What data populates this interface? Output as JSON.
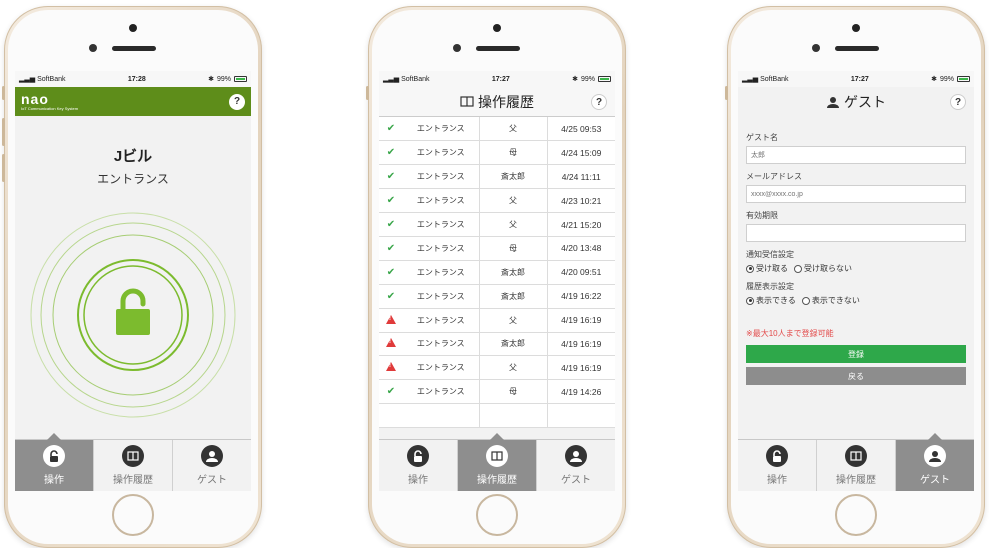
{
  "status": {
    "carrier": "SoftBank",
    "battery": "99%",
    "time_1": "17:28",
    "time_2": "17:27",
    "time_3": "17:27"
  },
  "colors": {
    "brand_green": "#5e8d1a",
    "ok_green": "#3aa64a",
    "warn_red": "#e03a3a",
    "button_green": "#2ea84a",
    "button_gray": "#8d8d8d",
    "active_tab": "#8e8e8e"
  },
  "screen1": {
    "logo": "nao",
    "logo_sub": "IoT Communication Key System",
    "help": "?",
    "building": "Jビル",
    "entrance": "エントランス",
    "lock_icon": "unlocked-padlock-icon"
  },
  "screen2": {
    "title": "操作履歴",
    "title_icon": "book-icon",
    "help": "?",
    "rows": [
      {
        "status": "ok",
        "location": "エントランス",
        "who": "父",
        "time": "4/25 09:53"
      },
      {
        "status": "ok",
        "location": "エントランス",
        "who": "母",
        "time": "4/24 15:09"
      },
      {
        "status": "ok",
        "location": "エントランス",
        "who": "斎太郎",
        "time": "4/24 11:11"
      },
      {
        "status": "ok",
        "location": "エントランス",
        "who": "父",
        "time": "4/23 10:21"
      },
      {
        "status": "ok",
        "location": "エントランス",
        "who": "父",
        "time": "4/21 15:20"
      },
      {
        "status": "ok",
        "location": "エントランス",
        "who": "母",
        "time": "4/20 13:48"
      },
      {
        "status": "ok",
        "location": "エントランス",
        "who": "斎太郎",
        "time": "4/20 09:51"
      },
      {
        "status": "ok",
        "location": "エントランス",
        "who": "斎太郎",
        "time": "4/19 16:22"
      },
      {
        "status": "warn",
        "location": "エントランス",
        "who": "父",
        "time": "4/19 16:19"
      },
      {
        "status": "warn",
        "location": "エントランス",
        "who": "斎太郎",
        "time": "4/19 16:19"
      },
      {
        "status": "warn",
        "location": "エントランス",
        "who": "父",
        "time": "4/19 16:19"
      },
      {
        "status": "ok",
        "location": "エントランス",
        "who": "母",
        "time": "4/19 14:26"
      },
      {
        "status": "",
        "location": "",
        "who": "",
        "time": ""
      }
    ]
  },
  "screen3": {
    "title": "ゲスト",
    "title_icon": "guest-icon",
    "help": "?",
    "guest_name_label": "ゲスト名",
    "guest_name_placeholder": "太郎",
    "email_label": "メールアドレス",
    "email_placeholder": "xxxx@xxxx.co.jp",
    "expiry_label": "有効期限",
    "expiry_value": "",
    "notify_label": "通知受信設定",
    "notify_options": [
      "受け取る",
      "受け取らない"
    ],
    "notify_selected": 0,
    "history_label": "履歴表示設定",
    "history_options": [
      "表示できる",
      "表示できない"
    ],
    "history_selected": 0,
    "note": "※最大10人まで登録可能",
    "register": "登録",
    "back": "戻る"
  },
  "tabs": [
    {
      "label": "操作",
      "icon": "unlock-icon"
    },
    {
      "label": "操作履歴",
      "icon": "book-icon"
    },
    {
      "label": "ゲスト",
      "icon": "guest-icon"
    }
  ]
}
